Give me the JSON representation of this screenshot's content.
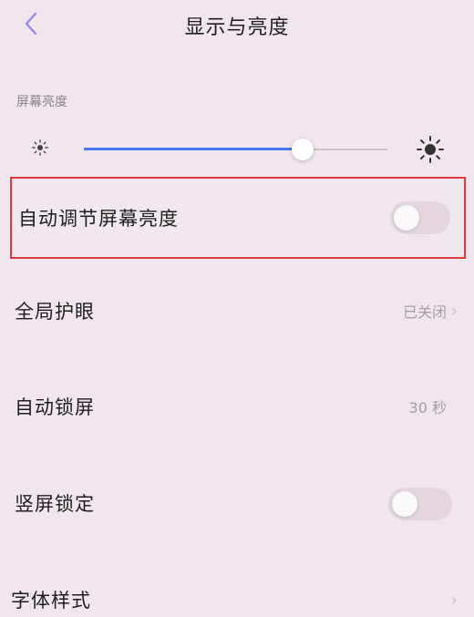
{
  "header": {
    "title": "显示与亮度",
    "back_icon": "chevron-left-icon"
  },
  "brightness": {
    "section_label": "屏幕亮度",
    "level": 0.72,
    "accent_color": "#4a78f0",
    "icons": [
      "sun-small-icon",
      "sun-large-icon"
    ]
  },
  "rows": {
    "auto_brightness": {
      "label": "自动调节屏幕亮度",
      "toggle_on": false
    },
    "eye_protection": {
      "label": "全局护眼",
      "value": "已关闭"
    },
    "auto_lock": {
      "label": "自动锁屏",
      "value": "30 秒"
    },
    "portrait_lock": {
      "label": "竖屏锁定",
      "toggle_on": false
    },
    "font_style": {
      "label": "字体样式"
    }
  },
  "highlight_color": "#e0393e"
}
